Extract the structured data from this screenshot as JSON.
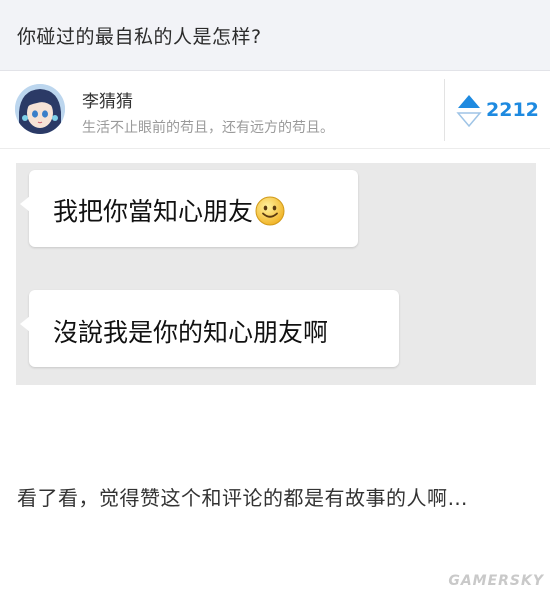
{
  "question": {
    "title": "你碰过的最自私的人是怎样?"
  },
  "author": {
    "name": "李猜猜",
    "bio": "生活不止眼前的苟且，还有远方的苟且。"
  },
  "vote": {
    "count": "2212",
    "accent_color": "#1e8ae0"
  },
  "chat": {
    "messages": [
      {
        "text": "我把你當知心朋友",
        "emoji": "smiley-emoji"
      },
      {
        "text": "沒說我是你的知心朋友啊"
      }
    ]
  },
  "comment": {
    "text": "看了看，觉得赞这个和评论的都是有故事的人啊…"
  },
  "watermark": {
    "text": "GAMERSKY"
  }
}
